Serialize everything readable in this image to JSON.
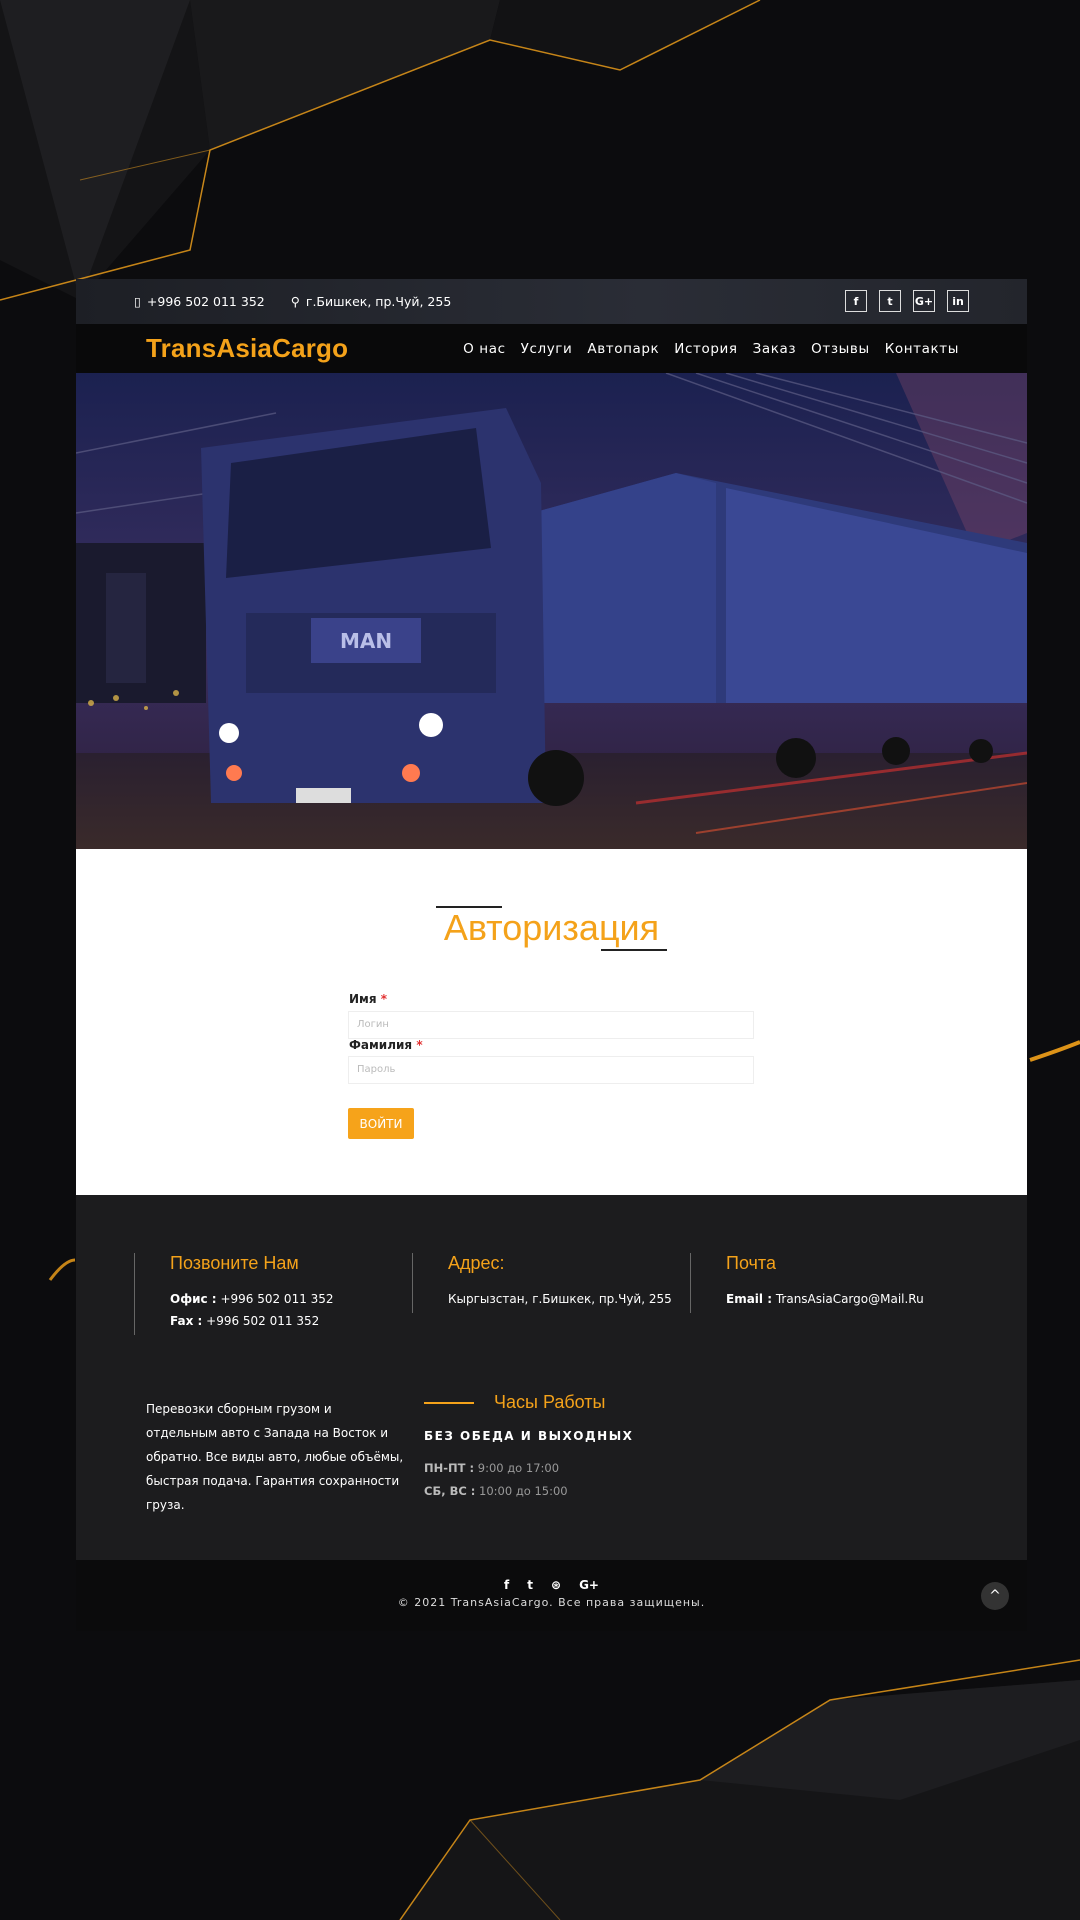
{
  "topbar": {
    "phone": "+996 502 011 352",
    "address": "г.Бишкек, пр.Чуй, 255",
    "socials": [
      "f",
      "t",
      "G+",
      "in"
    ]
  },
  "nav": {
    "logo": "TransAsiaCargo",
    "items": [
      "О нас",
      "Услуги",
      "Автопарк",
      "История",
      "Заказ",
      "Отзывы",
      "Контакты"
    ]
  },
  "auth": {
    "title": "Авторизация",
    "name_label": "Имя",
    "name_placeholder": "Логин",
    "surname_label": "Фамилия",
    "surname_placeholder": "Пароль",
    "required_mark": "*",
    "submit_label": "ВОЙТИ"
  },
  "footer": {
    "call": {
      "title": "Позвоните Нам",
      "office_label": "Офис :",
      "office_value": "+996 502 011 352",
      "fax_label": "Fax :",
      "fax_value": "+996 502 011 352"
    },
    "address": {
      "title": "Адрес:",
      "value": "Кыргызстан, г.Бишкек, пр.Чуй, 255"
    },
    "mail": {
      "title": "Почта",
      "email_label": "Email :",
      "email_value": "TransAsiaCargo@Mail.Ru"
    },
    "about": "Перевозки сборным грузом и отдельным авто с Запада на Восток и обратно. Все виды авто, любые объёмы, быстрая подача. Гарантия сохранности груза.",
    "hours": {
      "title": "Часы Работы",
      "subtitle": "БЕЗ ОБЕДА И ВЫХОДНЫХ",
      "weekday_label": "ПН-ПТ :",
      "weekday_value": "9:00 до 17:00",
      "weekend_label": "СБ, ВС :",
      "weekend_value": "10:00 до 15:00"
    }
  },
  "bottom": {
    "icons": [
      "f",
      "t",
      "⊛",
      "G+"
    ],
    "copyright": "© 2021 TransAsiaCargo. Все права защищены.",
    "to_top": "^"
  },
  "colors": {
    "accent": "#f4a21a",
    "dark": "#1c1c1e",
    "required": "#e23030"
  }
}
